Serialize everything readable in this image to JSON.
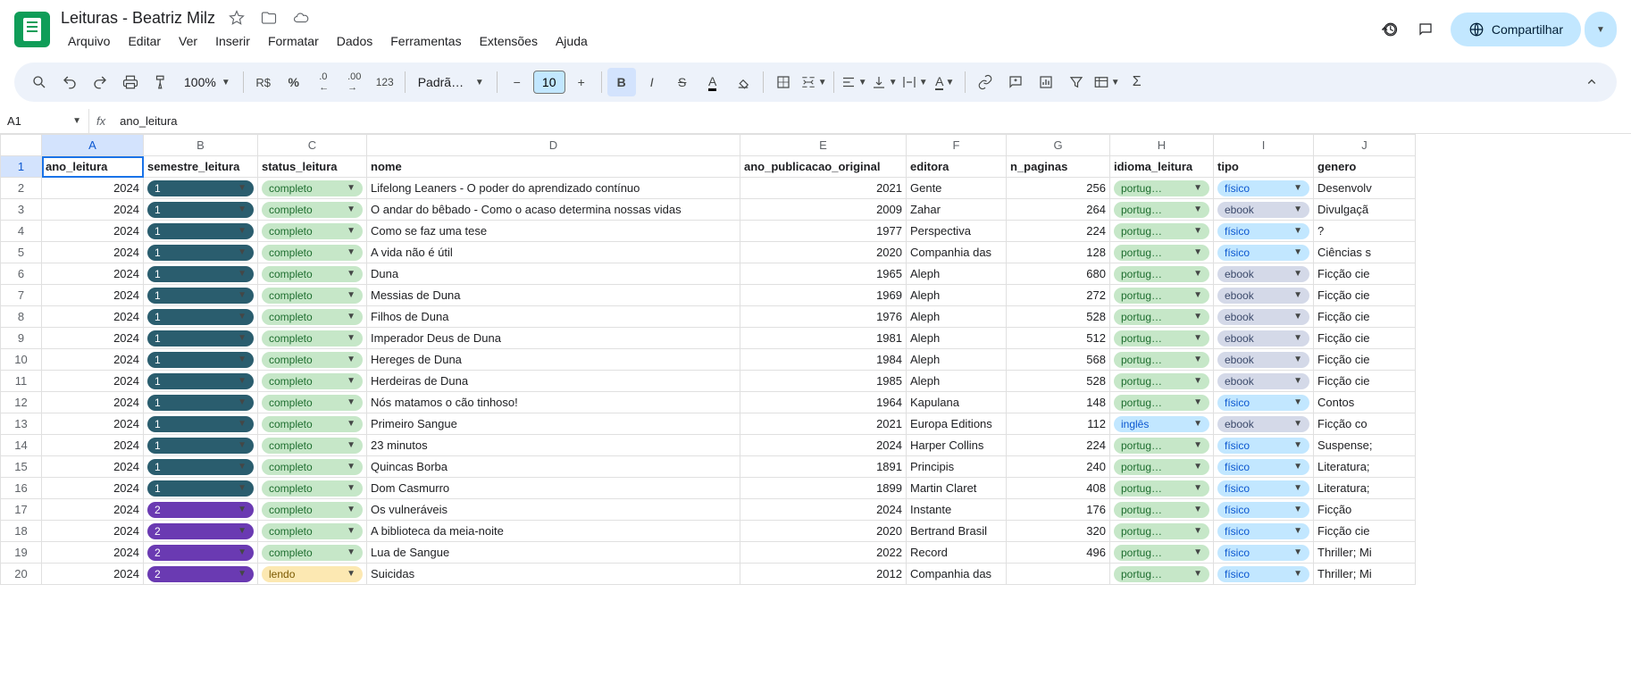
{
  "doc": {
    "title": "Leituras - Beatriz Milz"
  },
  "menu": {
    "arquivo": "Arquivo",
    "editar": "Editar",
    "ver": "Ver",
    "inserir": "Inserir",
    "formatar": "Formatar",
    "dados": "Dados",
    "ferramentas": "Ferramentas",
    "extensoes": "Extensões",
    "ajuda": "Ajuda"
  },
  "share": {
    "label": "Compartilhar"
  },
  "toolbar": {
    "zoom": "100%",
    "currency": "R$",
    "percent": "%",
    "decdec": ".0",
    "decinc": ".00",
    "num123": "123",
    "font": "Padrã…",
    "fontsize": "10"
  },
  "namebox": "A1",
  "formula": "ano_leitura",
  "columns": [
    "A",
    "B",
    "C",
    "D",
    "E",
    "F",
    "G",
    "H",
    "I",
    "J"
  ],
  "headers": {
    "ano_leitura": "ano_leitura",
    "semestre_leitura": "semestre_leitura",
    "status_leitura": "status_leitura",
    "nome": "nome",
    "ano_publicacao_original": "ano_publicacao_original",
    "editora": "editora",
    "n_paginas": "n_paginas",
    "idioma_leitura": "idioma_leitura",
    "tipo": "tipo",
    "genero": "genero"
  },
  "rows": [
    {
      "ano": "2024",
      "sem": "1",
      "status": "completo",
      "nome": "Lifelong Leaners - O poder do aprendizado contínuo",
      "pub": "2021",
      "ed": "Gente",
      "pg": "256",
      "idioma": "portug…",
      "tipo": "físico",
      "gen": "Desenvolv"
    },
    {
      "ano": "2024",
      "sem": "1",
      "status": "completo",
      "nome": "O andar do bêbado - Como o acaso determina nossas vidas",
      "pub": "2009",
      "ed": "Zahar",
      "pg": "264",
      "idioma": "portug…",
      "tipo": "ebook",
      "gen": "Divulgaçã"
    },
    {
      "ano": "2024",
      "sem": "1",
      "status": "completo",
      "nome": "Como se faz uma tese",
      "pub": "1977",
      "ed": "Perspectiva",
      "pg": "224",
      "idioma": "portug…",
      "tipo": "físico",
      "gen": "?"
    },
    {
      "ano": "2024",
      "sem": "1",
      "status": "completo",
      "nome": "A vida não é útil",
      "pub": "2020",
      "ed": "Companhia das",
      "pg": "128",
      "idioma": "portug…",
      "tipo": "físico",
      "gen": "Ciências s"
    },
    {
      "ano": "2024",
      "sem": "1",
      "status": "completo",
      "nome": "Duna",
      "pub": "1965",
      "ed": "Aleph",
      "pg": "680",
      "idioma": "portug…",
      "tipo": "ebook",
      "gen": "Ficção cie"
    },
    {
      "ano": "2024",
      "sem": "1",
      "status": "completo",
      "nome": "Messias de Duna",
      "pub": "1969",
      "ed": "Aleph",
      "pg": "272",
      "idioma": "portug…",
      "tipo": "ebook",
      "gen": "Ficção cie"
    },
    {
      "ano": "2024",
      "sem": "1",
      "status": "completo",
      "nome": "Filhos de Duna",
      "pub": "1976",
      "ed": "Aleph",
      "pg": "528",
      "idioma": "portug…",
      "tipo": "ebook",
      "gen": "Ficção cie"
    },
    {
      "ano": "2024",
      "sem": "1",
      "status": "completo",
      "nome": "Imperador Deus de Duna",
      "pub": "1981",
      "ed": "Aleph",
      "pg": "512",
      "idioma": "portug…",
      "tipo": "ebook",
      "gen": "Ficção cie"
    },
    {
      "ano": "2024",
      "sem": "1",
      "status": "completo",
      "nome": "Hereges de Duna",
      "pub": "1984",
      "ed": "Aleph",
      "pg": "568",
      "idioma": "portug…",
      "tipo": "ebook",
      "gen": "Ficção cie"
    },
    {
      "ano": "2024",
      "sem": "1",
      "status": "completo",
      "nome": "Herdeiras de Duna",
      "pub": "1985",
      "ed": "Aleph",
      "pg": "528",
      "idioma": "portug…",
      "tipo": "ebook",
      "gen": "Ficção cie"
    },
    {
      "ano": "2024",
      "sem": "1",
      "status": "completo",
      "nome": "Nós matamos o cão tinhoso!",
      "pub": "1964",
      "ed": "Kapulana",
      "pg": "148",
      "idioma": "portug…",
      "tipo": "físico",
      "gen": "Contos"
    },
    {
      "ano": "2024",
      "sem": "1",
      "status": "completo",
      "nome": "Primeiro Sangue",
      "pub": "2021",
      "ed": "Europa Editions",
      "pg": "112",
      "idioma": "inglês",
      "tipo": "ebook",
      "gen": "Ficção co"
    },
    {
      "ano": "2024",
      "sem": "1",
      "status": "completo",
      "nome": "23 minutos",
      "pub": "2024",
      "ed": "Harper Collins",
      "pg": "224",
      "idioma": "portug…",
      "tipo": "físico",
      "gen": "Suspense;"
    },
    {
      "ano": "2024",
      "sem": "1",
      "status": "completo",
      "nome": "Quincas Borba",
      "pub": "1891",
      "ed": "Principis",
      "pg": "240",
      "idioma": "portug…",
      "tipo": "físico",
      "gen": "Literatura;"
    },
    {
      "ano": "2024",
      "sem": "1",
      "status": "completo",
      "nome": "Dom Casmurro",
      "pub": "1899",
      "ed": "Martin Claret",
      "pg": "408",
      "idioma": "portug…",
      "tipo": "físico",
      "gen": "Literatura;"
    },
    {
      "ano": "2024",
      "sem": "2",
      "status": "completo",
      "nome": "Os vulneráveis",
      "pub": "2024",
      "ed": "Instante",
      "pg": "176",
      "idioma": "portug…",
      "tipo": "físico",
      "gen": "Ficção"
    },
    {
      "ano": "2024",
      "sem": "2",
      "status": "completo",
      "nome": "A biblioteca da meia-noite",
      "pub": "2020",
      "ed": "Bertrand Brasil",
      "pg": "320",
      "idioma": "portug…",
      "tipo": "físico",
      "gen": "Ficção cie"
    },
    {
      "ano": "2024",
      "sem": "2",
      "status": "completo",
      "nome": "Lua de Sangue",
      "pub": "2022",
      "ed": "Record",
      "pg": "496",
      "idioma": "portug…",
      "tipo": "físico",
      "gen": "Thriller; Mi"
    },
    {
      "ano": "2024",
      "sem": "2",
      "status": "lendo",
      "nome": "Suicidas",
      "pub": "2012",
      "ed": "Companhia das",
      "pg": "",
      "idioma": "portug…",
      "tipo": "físico",
      "gen": "Thriller; Mi"
    }
  ]
}
